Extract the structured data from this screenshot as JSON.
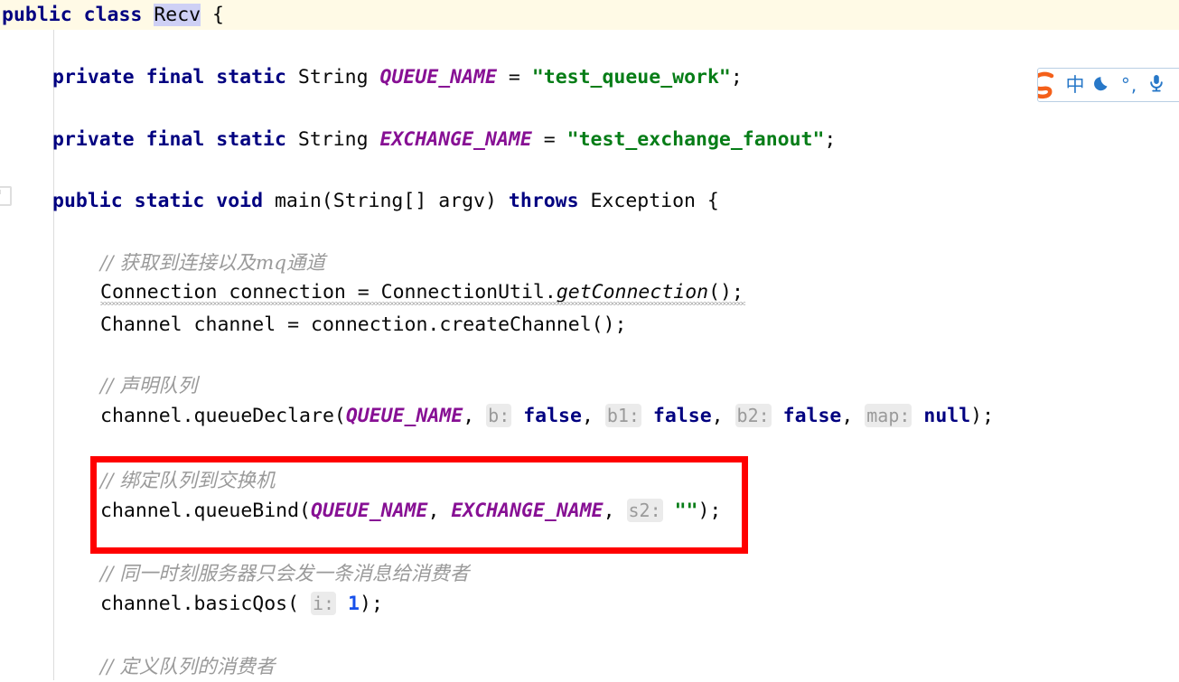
{
  "editor": {
    "language": "java",
    "class_name": "Recv",
    "caret_line_color": "#fffae6",
    "selection_color": "#ced0f5",
    "colors": {
      "keyword": "#000080",
      "constant": "#871094",
      "string": "#067d17",
      "number": "#1750eb",
      "comment": "#9a9a9a",
      "inlay_hint_bg": "#ebebeb",
      "inlay_hint_text": "#9a9a9a",
      "annotation": "#ff0000",
      "background": "#ffffff"
    },
    "lines": {
      "l1": {
        "kw_public": "public",
        "kw_class": "class",
        "name": "Recv",
        "brace": "{"
      },
      "l2": {
        "kw_private": "private",
        "kw_final": "final",
        "kw_static": "static",
        "type": "String",
        "const_name": "QUEUE_NAME",
        "eq": "=",
        "value": "\"test_queue_work\"",
        "semi": ";"
      },
      "l3": {
        "kw_private": "private",
        "kw_final": "final",
        "kw_static": "static",
        "type": "String",
        "const_name": "EXCHANGE_NAME",
        "eq": "=",
        "value": "\"test_exchange_fanout\"",
        "semi": ";"
      },
      "l4": {
        "kw_public": "public",
        "kw_static": "static",
        "kw_void": "void",
        "method": "main(String[] argv) ",
        "kw_throws": "throws",
        "exception": " Exception {"
      },
      "l5_comment": "// 获取到连接以及mq通道",
      "l6": {
        "text_a": "Connection connection = ConnectionUtil.",
        "method": "getConnection",
        "text_b": "();"
      },
      "l7": "Channel channel = connection.createChannel();",
      "l8_comment": "// 声明队列",
      "l9": {
        "prefix": "channel.queueDeclare(",
        "arg1": "QUEUE_NAME",
        "comma1": ", ",
        "hint1": "b:",
        "val1": "false",
        "comma2": ", ",
        "hint2": "b1:",
        "val2": "false",
        "comma3": ", ",
        "hint3": "b2:",
        "val3": "false",
        "comma4": ", ",
        "hint4": "map:",
        "val4": "null",
        "suffix": ");"
      },
      "l10_comment": "// 绑定队列到交换机",
      "l11": {
        "prefix": "channel.queueBind(",
        "arg1": "QUEUE_NAME",
        "comma1": ", ",
        "arg2": "EXCHANGE_NAME",
        "comma2": ", ",
        "hint1": "s2:",
        "val1": "\"\"",
        "suffix": ");"
      },
      "l12_comment": "// 同一时刻服务器只会发一条消息给消费者",
      "l13": {
        "prefix": "channel.basicQos( ",
        "hint1": "i:",
        "val1": "1",
        "suffix": ");"
      },
      "l14_comment": "// 定义队列的消费者"
    }
  },
  "ime_toolbar": {
    "logo": "sogou-logo",
    "buttons": [
      {
        "name": "language-mode",
        "label": "中"
      },
      {
        "name": "moon-mode",
        "label": "moon-icon"
      },
      {
        "name": "punctuation-mode",
        "label": "°,"
      },
      {
        "name": "voice-input",
        "label": "microphone-icon"
      }
    ]
  }
}
